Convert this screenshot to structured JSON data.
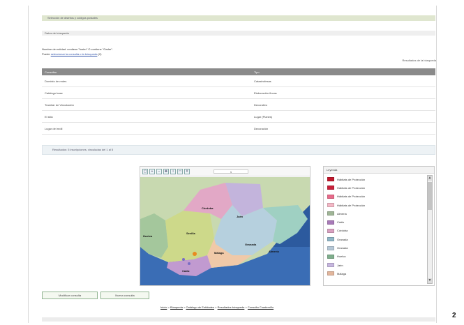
{
  "header": {
    "title": "Selección de distritos y códigos postales"
  },
  "subheader": {
    "title": "Datos de búsqueda"
  },
  "info": {
    "line1": "Nombre de entidad: contiene \"fuster\" O contiene \"Gadar\".",
    "line2_prefix": "Puede",
    "line2_link": "seleccionar la consulta o la búsqueda",
    "line2_suffix": "(2)"
  },
  "results_info": "Resultados de la búsqueda",
  "table": {
    "headers": [
      "Consultar",
      "Tipo"
    ],
    "rows": [
      [
        "Dominio de redes",
        "Catastrofesas"
      ],
      [
        "Catálogo base",
        "Elaboración fincas"
      ],
      [
        "Tramitar de Vinculación",
        "Decorativo"
      ],
      [
        "El sitio",
        "Lugar (Planes)"
      ],
      [
        "Lugar del redil",
        "Decoración"
      ]
    ]
  },
  "results_bar": "Resultados: 5 inscripciones, vinculadas del 1 al 5",
  "map": {
    "toolbar_icons": [
      "select-tool-icon",
      "zoom-in-icon",
      "zoom-out-icon",
      "pan-icon",
      "info-icon",
      "box-select-icon",
      "grid-icon"
    ],
    "scale_text": "1",
    "labels": [
      "Córdoba",
      "Jaén",
      "Sevilla",
      "Huelva",
      "Granada",
      "Almería",
      "Málaga",
      "Cádiz"
    ]
  },
  "legend": {
    "title": "Leyenda",
    "items": [
      {
        "label": "Hábitats de Protección",
        "color": "#c0182c"
      },
      {
        "label": "Hábitats de Protección",
        "color": "#c8203a"
      },
      {
        "label": "Hábitats de Protección",
        "color": "#e86a8a"
      },
      {
        "label": "Hábitats de Protección",
        "color": "#f3b7c5"
      },
      {
        "label": "Almería",
        "color": "#9fb596"
      },
      {
        "label": "Cádiz",
        "color": "#a87ab8"
      },
      {
        "label": "Córdoba",
        "color": "#d8a0c0"
      },
      {
        "label": "Granada",
        "color": "#8fb6c6"
      },
      {
        "label": "Granada",
        "color": "#b5c7d6"
      },
      {
        "label": "Huelva",
        "color": "#7fae8c"
      },
      {
        "label": "Jaén",
        "color": "#c6b6de"
      },
      {
        "label": "Málaga",
        "color": "#e2b69c"
      }
    ]
  },
  "buttons": {
    "first": "Modificar consulta",
    "second": "Nueva consulta"
  },
  "breadcrumb": {
    "items": [
      "Inicio",
      "Búsqueda",
      "Catálogo de Entidades",
      "Resultados búsqueda",
      "Consulta Cuadernillo"
    ],
    "separator": ">"
  },
  "page_number": "2",
  "colors": {
    "header_bg": "#dfe6cf",
    "table_header": "#8a8a8a",
    "accent": "#3355aa"
  }
}
